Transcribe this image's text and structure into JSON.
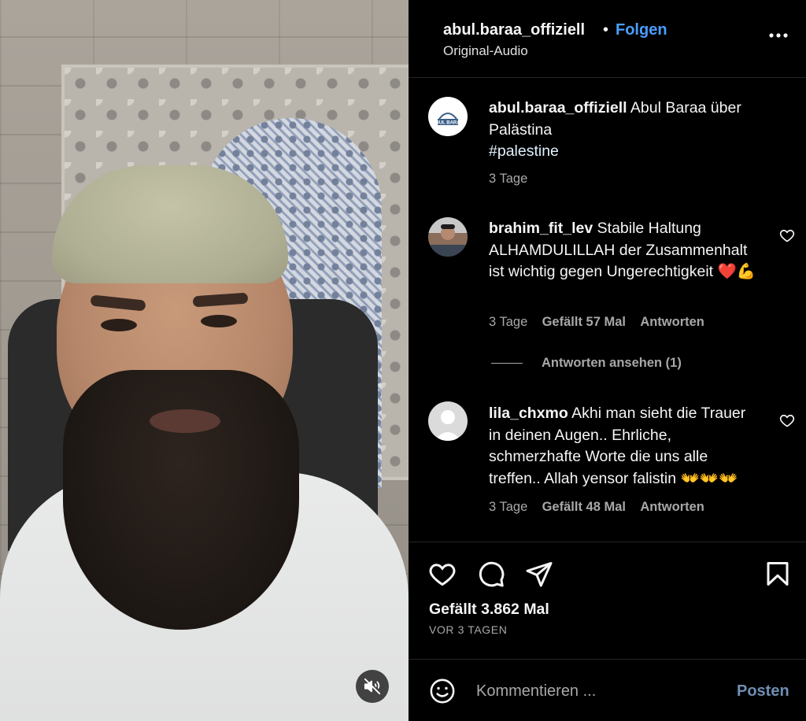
{
  "header": {
    "username": "abul.baraa_offiziell",
    "separator": "•",
    "follow_label": "Folgen",
    "audio_label": "Original-Audio",
    "more_icon": "more-horizontal-icon"
  },
  "caption": {
    "avatar_text": "ABUL BARAA",
    "username": "abul.baraa_offiziell",
    "text": "Abul Baraa über Palästina",
    "hashtag": "#palestine",
    "time": "3 Tage"
  },
  "comments": [
    {
      "username": "brahim_fit_lev",
      "text": "Stabile Haltung ALHAMDULILLAH der Zusammenhalt ist wichtig gegen Ungerechtigkeit ❤️💪",
      "time": "3 Tage",
      "likes": "Gefällt 57 Mal",
      "reply_label": "Antworten",
      "view_replies": "Antworten ansehen (1)"
    },
    {
      "username": "lila_chxmo",
      "text": "Akhi man sieht die Trauer in deinen Augen.. Ehrliche, schmerzhafte Worte die uns alle treffen.. Allah yensor falistin 👐👐👐",
      "time": "3 Tage",
      "likes": "Gefällt 48 Mal",
      "reply_label": "Antworten"
    }
  ],
  "actions": {
    "likes_count": "Gefällt 3.862 Mal",
    "date": "VOR 3 TAGEN"
  },
  "comment_box": {
    "placeholder": "Kommentieren ...",
    "post_label": "Posten"
  },
  "colors": {
    "accent": "#4a9eff",
    "post_button": "#6f8fb3",
    "muted_text": "#a8a8a8",
    "background": "#000000"
  }
}
